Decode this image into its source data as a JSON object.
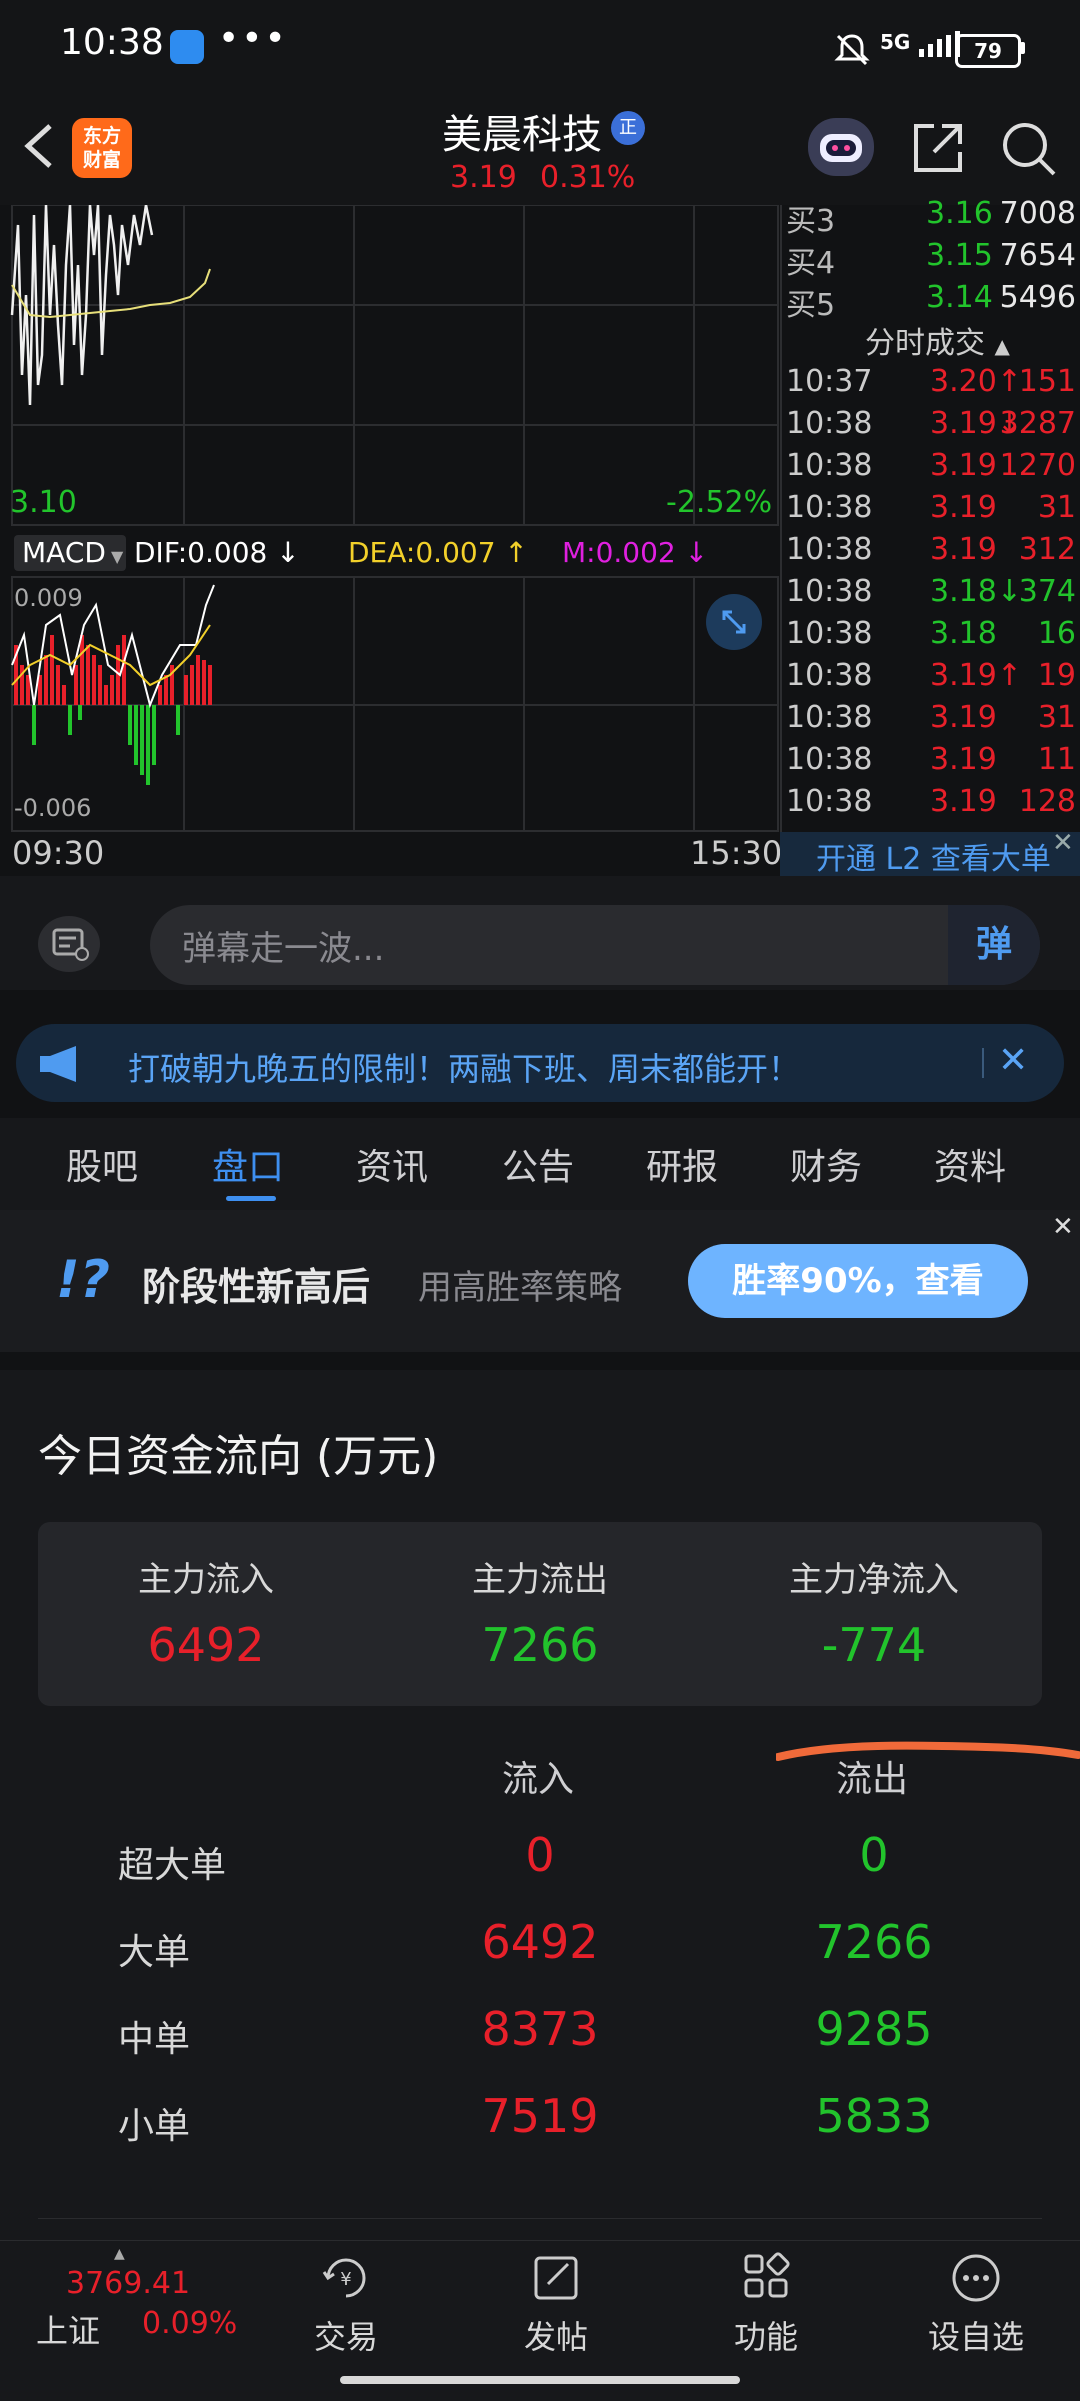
{
  "status_bar": {
    "time": "10:38",
    "dots": "•••",
    "network": "5G",
    "battery": "79"
  },
  "header": {
    "logo_text": "东方\n财富",
    "title": "美晨科技",
    "badge": "正",
    "price": "3.19",
    "change_pct": "0.31%"
  },
  "chart": {
    "price_low": "3.10",
    "pct_low": "-2.52%",
    "macd_label": "MACD",
    "dif": "DIF:0.008",
    "dea": "DEA:0.007",
    "m": "M:0.002",
    "macd_max": "0.009",
    "macd_min": "-0.006",
    "time_start": "09:30",
    "time_end": "15:30"
  },
  "order_book": {
    "buy_levels": [
      {
        "label": "买3",
        "price": "3.16",
        "volume": "7008"
      },
      {
        "label": "买4",
        "price": "3.15",
        "volume": "7654"
      },
      {
        "label": "买5",
        "price": "3.14",
        "volume": "5496"
      }
    ],
    "trades_title": "分时成交",
    "trades": [
      {
        "time": "10:37",
        "price": "3.20",
        "arrow": "↑",
        "volume": "151",
        "color": "red"
      },
      {
        "time": "10:38",
        "price": "3.19",
        "arrow": "↓",
        "volume": "3287",
        "color": "red"
      },
      {
        "time": "10:38",
        "price": "3.19",
        "arrow": "",
        "volume": "1270",
        "color": "red"
      },
      {
        "time": "10:38",
        "price": "3.19",
        "arrow": "",
        "volume": "31",
        "color": "red"
      },
      {
        "time": "10:38",
        "price": "3.19",
        "arrow": "",
        "volume": "312",
        "color": "red"
      },
      {
        "time": "10:38",
        "price": "3.18",
        "arrow": "↓",
        "volume": "374",
        "color": "green"
      },
      {
        "time": "10:38",
        "price": "3.18",
        "arrow": "",
        "volume": "16",
        "color": "green"
      },
      {
        "time": "10:38",
        "price": "3.19",
        "arrow": "↑",
        "volume": "19",
        "color": "red"
      },
      {
        "time": "10:38",
        "price": "3.19",
        "arrow": "",
        "volume": "31",
        "color": "red"
      },
      {
        "time": "10:38",
        "price": "3.19",
        "arrow": "",
        "volume": "11",
        "color": "red"
      },
      {
        "time": "10:38",
        "price": "3.19",
        "arrow": "",
        "volume": "128",
        "color": "red"
      }
    ],
    "l2_text": "开通 L2 查看大单"
  },
  "danmu": {
    "placeholder": "弹幕走一波...",
    "button": "弹"
  },
  "notice": {
    "text": "打破朝九晚五的限制！两融下班、周末都能开！"
  },
  "tabs": [
    "股吧",
    "盘口",
    "资讯",
    "公告",
    "研报",
    "财务",
    "资料"
  ],
  "active_tab": "盘口",
  "banner": {
    "title": "阶段性新高后",
    "subtitle": "用高胜率策略",
    "button": "胜率90%，查看"
  },
  "fund_flow": {
    "title": "今日资金流向 (万元)",
    "summary": [
      {
        "label": "主力流入",
        "value": "6492",
        "color": "red"
      },
      {
        "label": "主力流出",
        "value": "7266",
        "color": "green"
      },
      {
        "label": "主力净流入",
        "value": "-774",
        "color": "green"
      }
    ],
    "col_in": "流入",
    "col_out": "流出",
    "rows": [
      {
        "label": "超大单",
        "in": "0",
        "out": "0"
      },
      {
        "label": "大单",
        "in": "6492",
        "out": "7266"
      },
      {
        "label": "中单",
        "in": "8373",
        "out": "9285"
      },
      {
        "label": "小单",
        "in": "7519",
        "out": "5833"
      }
    ]
  },
  "bottom_bar": {
    "index_value": "3769.41",
    "index_name": "上证",
    "index_pct": "0.09%",
    "items": [
      {
        "label": "交易",
        "icon": "trade-icon"
      },
      {
        "label": "发帖",
        "icon": "edit-icon"
      },
      {
        "label": "功能",
        "icon": "grid-icon"
      },
      {
        "label": "设自选",
        "icon": "more-icon"
      }
    ]
  }
}
